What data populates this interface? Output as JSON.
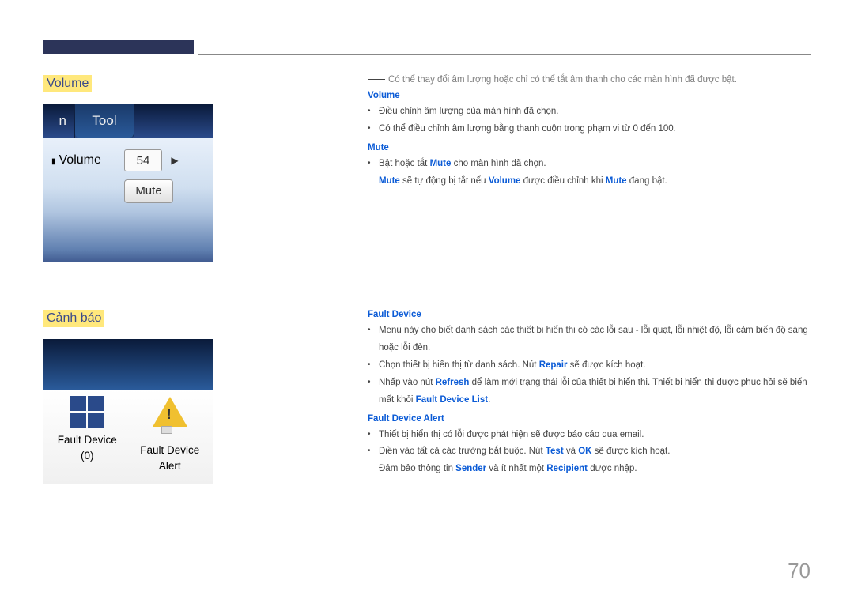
{
  "section1": {
    "title": "Volume",
    "note": "Có thể thay đổi âm lượng hoặc chỉ có thể tắt âm thanh cho các màn hình đã được bật.",
    "sub_volume": "Volume",
    "sub_volume_items": [
      "Điều chỉnh âm lượng của màn hình đã chọn.",
      "Có thể điều chỉnh âm lượng bằng thanh cuộn trong phạm vi từ 0 đến 100."
    ],
    "sub_mute": "Mute",
    "sub_mute_item": "Bật hoặc tắt ",
    "sub_mute_item_kw1": "Mute",
    "sub_mute_item_tail": " cho màn hình đã chọn.",
    "sub_mute_note_p1": "Mute",
    "sub_mute_note_p2": " sẽ tự động bị tắt nếu ",
    "sub_mute_note_p3": "Volume",
    "sub_mute_note_p4": " được điều chỉnh khi ",
    "sub_mute_note_p5": "Mute",
    "sub_mute_note_p6": " đang bật.",
    "ui": {
      "tab_n": "n",
      "tab_tool": "Tool",
      "vol_label": "Volume",
      "vol_value": "54",
      "vol_arrow": "▶",
      "mute_btn": "Mute"
    }
  },
  "section2": {
    "title": "Cảnh báo",
    "ui": {
      "fd0_l1": "Fault Device",
      "fd0_l2": "(0)",
      "fda_l1": "Fault Device",
      "fda_l2": "Alert"
    },
    "fd_head": "Fault Device",
    "fd_items": {
      "i1": "Menu này cho biết danh sách các thiết bị hiển thị có các lỗi sau - lỗi quạt, lỗi nhiệt độ, lỗi cảm biến độ sáng hoặc lỗi đèn.",
      "i2_a": "Chọn thiết bị hiển thị từ danh sách. Nút ",
      "i2_kw": "Repair",
      "i2_b": " sẽ được kích hoạt.",
      "i3_a": "Nhấp vào nút ",
      "i3_kw1": "Refresh",
      "i3_b": " để làm mới trạng thái lỗi của thiết bị hiển thị. Thiết bị hiển thị được phục hồi sẽ biến mất khỏi ",
      "i3_kw2": "Fault Device List",
      "i3_c": "."
    },
    "fda_head": "Fault Device Alert",
    "fda_items": {
      "i1": "Thiết bị hiển thị có lỗi được phát hiện sẽ được báo cáo qua email.",
      "i2_a": "Điền vào tất cả các trường bắt buộc. Nút ",
      "i2_kw1": "Test",
      "i2_mid": " và ",
      "i2_kw2": "OK",
      "i2_b": " sẽ được kích hoạt.",
      "i2_line2_a": "Đảm bảo thông tin ",
      "i2_line2_kw1": "Sender",
      "i2_line2_mid": " và ít nhất một ",
      "i2_line2_kw2": "Recipient",
      "i2_line2_b": " được nhập."
    }
  },
  "page": "70"
}
